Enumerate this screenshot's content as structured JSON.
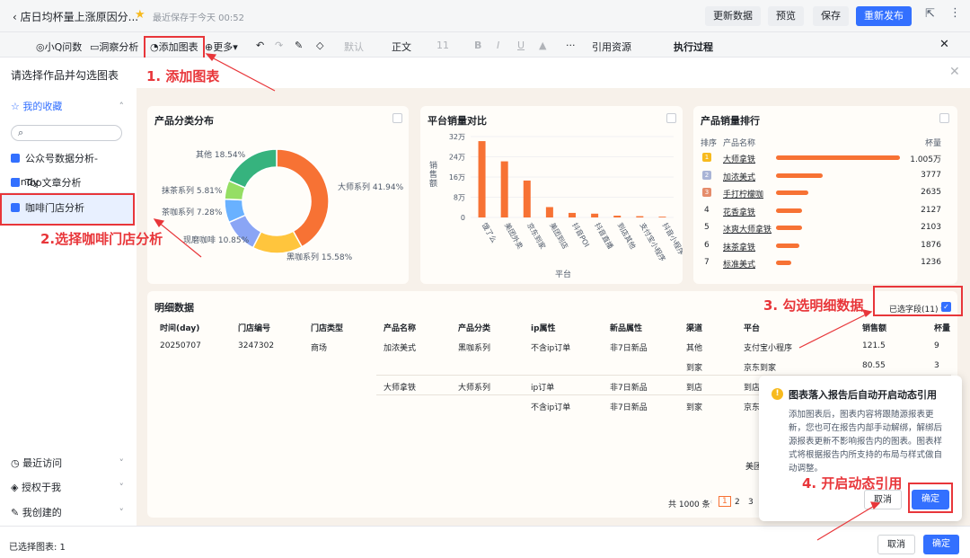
{
  "topbar": {
    "title": "店日均杯量上涨原因分...",
    "saved": "最近保存于今天 00:52",
    "buttons": [
      "更新数据",
      "预览",
      "保存",
      "重新发布"
    ]
  },
  "toolbar": {
    "items": [
      "小Q问数",
      "洞察分析",
      "添加图表",
      "更多"
    ],
    "font_family": "默认",
    "style": "正文",
    "font_size": "11",
    "cite": "引用资源",
    "panel_title": "执行过程"
  },
  "modal": {
    "title": "请选择作品并勾选图表"
  },
  "sidebar": {
    "fav": "我的收藏",
    "search_placeholder": "",
    "items": [
      "公众号数据分析-Cindy",
      "Top文章分析",
      "咖啡门店分析"
    ],
    "bottom": [
      "最近访问",
      "授权于我",
      "我创建的"
    ]
  },
  "donut": {
    "title": "产品分类分布",
    "labels": [
      "其他 18.54%",
      "大师系列 41.94%",
      "抹茶系列 5.81%",
      "茶咖系列 7.28%",
      "现磨咖啡 10.85%",
      "黑咖系列 15.58%"
    ]
  },
  "bar_chart": {
    "title": "平台销量对比",
    "ylabel": "销售额",
    "xlabel": "平台"
  },
  "chart_data": [
    {
      "type": "pie",
      "title": "产品分类分布",
      "categories": [
        "大师系列",
        "黑咖系列",
        "现磨咖啡",
        "茶咖系列",
        "抹茶系列",
        "其他"
      ],
      "values": [
        41.94,
        15.58,
        10.85,
        7.28,
        5.81,
        18.54
      ],
      "colors": [
        "#f77234",
        "#ffc53d",
        "#8aa5f5",
        "#69b1ff",
        "#95de64",
        "#36b37e"
      ]
    },
    {
      "type": "bar",
      "title": "平台销量对比",
      "xlabel": "平台",
      "ylabel": "销售额",
      "yticks": [
        "32万",
        "24万",
        "16万",
        "8万",
        "0"
      ],
      "ylim": [
        0,
        320000
      ],
      "categories": [
        "饿了么",
        "美团外卖",
        "京东到家",
        "美团到店",
        "抖音POI",
        "抖音直播",
        "到店其他",
        "支付宝小程序",
        "抖音小程序"
      ],
      "values": [
        302000,
        222000,
        146000,
        41000,
        18000,
        15000,
        7000,
        5000,
        3000
      ]
    }
  ],
  "ranking": {
    "title": "产品销量排行",
    "col_rank": "排序",
    "col_name": "产品名称",
    "col_unit": "杯量",
    "rows": [
      {
        "rank": "1",
        "name": "大师拿铁",
        "value": "1.005万",
        "share": 1.0
      },
      {
        "rank": "2",
        "name": "加浓美式",
        "value": "3777",
        "share": 0.376
      },
      {
        "rank": "3",
        "name": "手打柠檬咖",
        "value": "2635",
        "share": 0.262
      },
      {
        "rank": "4",
        "name": "花香拿铁",
        "value": "2127",
        "share": 0.212
      },
      {
        "rank": "5",
        "name": "冰爽大师拿铁",
        "value": "2103",
        "share": 0.209
      },
      {
        "rank": "6",
        "name": "抹茶拿铁",
        "value": "1876",
        "share": 0.187
      },
      {
        "rank": "7",
        "name": "标准美式",
        "value": "1236",
        "share": 0.123
      }
    ]
  },
  "detail": {
    "title": "明细数据",
    "selected_fields": "已选字段(11)",
    "headers": [
      "时间(day)",
      "门店编号",
      "门店类型",
      "产品名称",
      "产品分类",
      "ip属性",
      "新品属性",
      "渠道",
      "平台",
      "销售额",
      "杯量"
    ],
    "rows": [
      [
        "20250707",
        "3247302",
        "商场",
        "加浓美式",
        "黑咖系列",
        "不含ip订单",
        "非7日新品",
        "其他",
        "支付宝小程序",
        "121.5",
        "9"
      ],
      [
        "",
        "",
        "",
        "",
        "",
        "",
        "",
        "到家",
        "京东到家",
        "80.55",
        "3"
      ],
      [
        "",
        "",
        "",
        "大师拿铁",
        "大师系列",
        "ip订单",
        "非7日新品",
        "到店",
        "到店",
        "",
        " "
      ],
      [
        "",
        "",
        "",
        "",
        "",
        "不含ip订单",
        "非7日新品",
        "到家",
        "京东",
        "",
        " "
      ]
    ],
    "extra_cell": "美团",
    "total": "共 1000 条",
    "pages": [
      "1",
      "2",
      "3"
    ]
  },
  "tooltip": {
    "title": "图表落入报告后自动开启动态引用",
    "body": "添加图表后，图表内容将跟随源报表更新，您也可在报告内部手动解绑，解绑后源报表更新不影响报告内的图表。图表样式将根据报告内所支持的布局与样式做自动调整。",
    "cancel": "取消",
    "ok": "确定"
  },
  "footer": {
    "selected": "已选择图表: 1",
    "cancel": "取消",
    "ok": "确定"
  },
  "annotations": [
    "1. 添加图表",
    "2.选择咖啡门店分析",
    "3. 勾选明细数据",
    "4. 开启动态引用"
  ]
}
